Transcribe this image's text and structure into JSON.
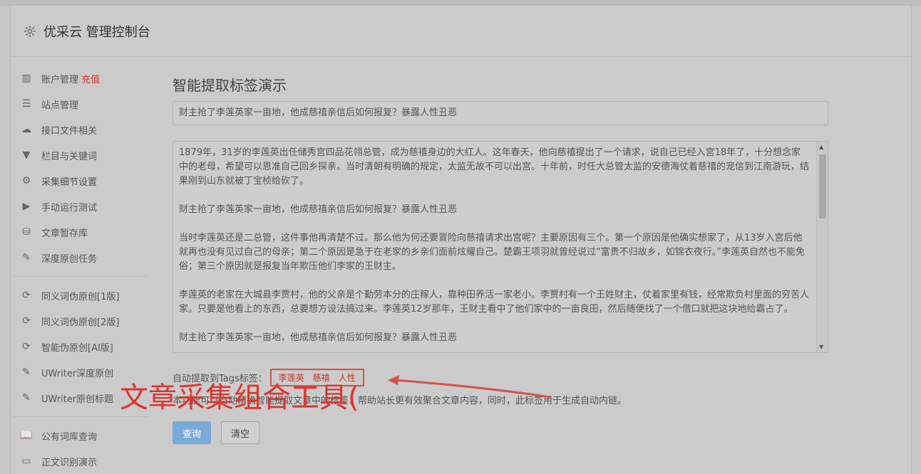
{
  "app": {
    "title": "优采云 管理控制台"
  },
  "sidebar": {
    "items": [
      {
        "label": "账户管理",
        "badge": "充值",
        "icon": "bar-chart-icon"
      },
      {
        "label": "站点管理",
        "icon": "server-icon"
      },
      {
        "label": "接口文件相关",
        "icon": "cloud-upload-icon"
      },
      {
        "label": "栏目与关键词",
        "icon": "filter-icon"
      },
      {
        "label": "采集细节设置",
        "icon": "gears-icon"
      },
      {
        "label": "手动运行测试",
        "icon": "play-icon"
      },
      {
        "label": "文章暂存库",
        "icon": "database-icon"
      },
      {
        "label": "深度原创任务",
        "icon": "edit-icon"
      }
    ],
    "items2": [
      {
        "label": "同义词伪原创[1版]",
        "icon": "refresh-icon"
      },
      {
        "label": "同义词伪原创[2版]",
        "icon": "refresh-icon"
      },
      {
        "label": "智能伪原创[AI版]",
        "icon": "refresh-icon"
      },
      {
        "label": "UWriter深度原创",
        "icon": "edit-icon"
      },
      {
        "label": "UWriter原创标题",
        "icon": "edit-icon"
      }
    ],
    "items3": [
      {
        "label": "公有词库查询",
        "icon": "book-icon"
      },
      {
        "label": "正文识别演示",
        "icon": "window-icon"
      }
    ]
  },
  "main": {
    "page_title": "智能提取标签演示",
    "title_input_value": "财主抢了李莲英家一亩地，他成慈禧亲信后如何报复？暴露人性丑恶",
    "content_paragraphs": [
      "1879年，31岁的李莲英出任储秀宫四品花翎总管，成为慈禧身边的大红人。这年春天，他向慈禧提出了一个请求，说自己已经入宫18年了，十分想念家中的老母，希望可以恩准自己回乡探亲。当时清朝有明确的规定，太监无故不可以出宫。十年前，时任大总管太监的安德海仗着慈禧的宠信到江南游玩，结果刚到山东就被丁宝桢给砍了。",
      "财主抢了李莲英家一亩地，他成慈禧亲信后如何报复？暴露人性丑恶",
      "当时李莲英还是二总管，这件事他再清楚不过。那么他为何还要冒险向慈禧请求出宫呢？主要原因有三个。第一个原因是他确实想家了，从13岁入宫后他就再也没有见过自己的母亲；第二个原因是急于在老家的乡亲们面前炫耀自己。楚霸王项羽就曾经说过“富贵不归故乡，如锦衣夜行。”李莲英自然也不能免俗；第三个原因就是报复当年欺压他们李家的王财主。",
      "李莲英的老家在大城县李贾村，他的父亲是个勤劳本分的庄稼人，靠种田养活一家老小。李贾村有一个王姓财主，仗着家里有钱，经常欺负村里面的穷苦人家。只要是他看上的东西，总要想方设法搞过来。李莲英12岁那年，王财主看中了他们家中的一亩良田，然后随便找了一个借口就把这块地给霸占了。",
      "财主抢了李莲英家一亩地，他成慈禧亲信后如何报复？暴露人性丑恶"
    ],
    "tags_label": "自动提取到Tags标签：",
    "tags": [
      "李莲英",
      "慈禧",
      "人性"
    ],
    "description": "本功能可以自动精确智能提取文章中的标签，帮助站长更有效聚合文章内容，同时，此标签用于生成自动内链。",
    "query_button": "查询",
    "clear_button": "清空"
  },
  "overlay_text": "文章采集组合工具(",
  "colors": {
    "accent_red": "#e0332c",
    "button_blue": "#7ba9d8"
  }
}
